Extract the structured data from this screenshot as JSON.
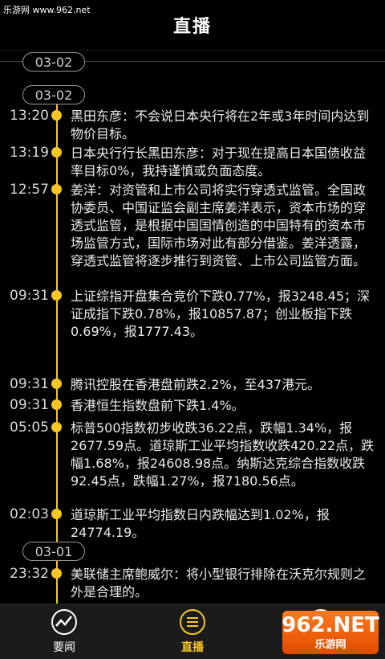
{
  "watermark_top": "乐游网 www.962.net",
  "header": {
    "title": "直播"
  },
  "dates": {
    "pill_top": "03-02",
    "pill_a": "03-02",
    "pill_b": "03-01"
  },
  "items": [
    {
      "time": "13:20",
      "text": "黑田东彦：不会说日本央行将在2年或3年时间内达到物价目标。"
    },
    {
      "time": "13:19",
      "text": "日本央行行长黑田东彦：对于现在提高日本国债收益率目标0%，我持谨慎或负面态度。"
    },
    {
      "time": "12:57",
      "text": "姜洋：对资管和上市公司将实行穿透式监管。全国政协委员、中国证监会副主席姜洋表示，资本市场的穿透式监管，是根据中国国情创造的中国特有的资本市场监管方式，国际市场对此有部分借鉴。姜洋透露，穿透式监管将逐步推行到资管、上市公司监管方面。"
    },
    {
      "time": "09:31",
      "text": "上证综指开盘集合竞价下跌0.77%，报3248.45；深证成指下跌0.78%，报10857.87；创业板指下跌0.69%，报1777.43。"
    },
    {
      "time": "09:31",
      "text": "腾讯控股在香港盘前跌2.2%，至437港元。"
    },
    {
      "time": "09:31",
      "text": "香港恒生指数盘前下跌1.4%。"
    },
    {
      "time": "05:05",
      "text": "标普500指数初步收跌36.22点，跌幅1.34%，报2677.59点。道琼斯工业平均指数收跌420.22点，跌幅1.68%，报24608.98点。纳斯达克综合指数收跌92.45点，跌幅1.27%，报7180.56点。"
    },
    {
      "time": "02:03",
      "text": "道琼斯工业平均指数日内跌幅达到1.02%，报24774.19。"
    },
    {
      "time": "23:32",
      "text": "美联储主席鲍威尔：将小型银行排除在沃克尔规则之外是合理的。"
    }
  ],
  "tabs": [
    {
      "label": "要闻",
      "icon": "trend-chart-icon"
    },
    {
      "label": "直播",
      "icon": "list-icon"
    },
    {
      "label": "自选",
      "icon": "location-pin-icon"
    }
  ],
  "logo": {
    "big": "962.NET",
    "small": "乐游网"
  },
  "colors": {
    "accent": "#f6c624",
    "background": "#000000"
  }
}
